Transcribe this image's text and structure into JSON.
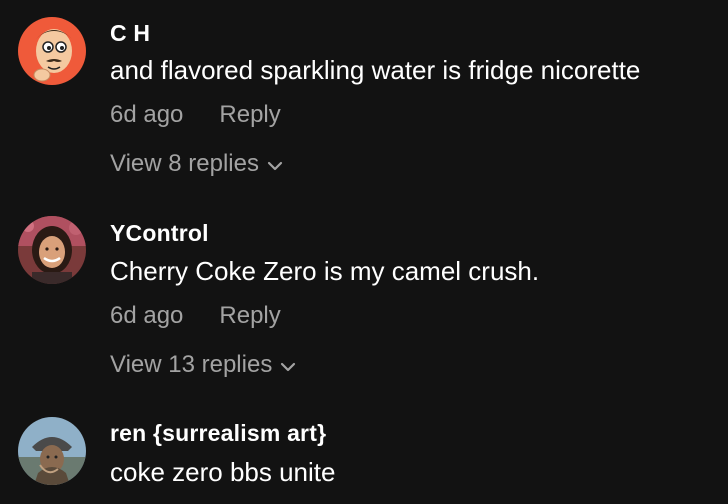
{
  "comments": [
    {
      "username": "C H",
      "text": "and flavored sparkling water is fridge nicorette",
      "time": "6d ago",
      "reply_label": "Reply",
      "view_replies": "View 8 replies",
      "avatar_icon": "cartoon-face-avatar"
    },
    {
      "username": "YControl",
      "text": "Cherry Coke Zero is my camel crush.",
      "time": "6d ago",
      "reply_label": "Reply",
      "view_replies": "View 13 replies",
      "avatar_icon": "photo-avatar"
    },
    {
      "username": "ren {surrealism art}",
      "text": "coke zero bbs unite",
      "avatar_icon": "art-avatar"
    }
  ],
  "colors": {
    "background": "#121212",
    "primary_text": "#ffffff",
    "secondary_text": "#a3a3a3"
  }
}
